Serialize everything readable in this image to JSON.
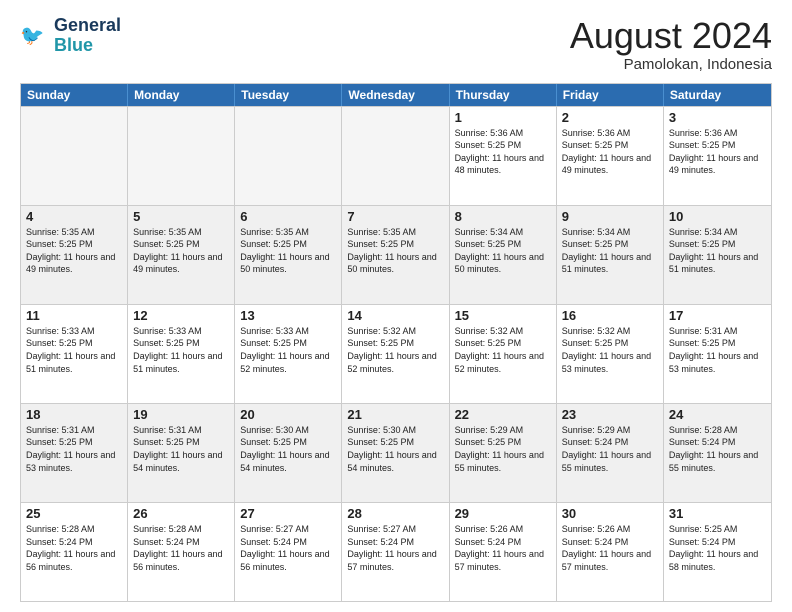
{
  "logo": {
    "line1": "General",
    "line2": "Blue"
  },
  "title": "August 2024",
  "location": "Pamolokan, Indonesia",
  "days": [
    "Sunday",
    "Monday",
    "Tuesday",
    "Wednesday",
    "Thursday",
    "Friday",
    "Saturday"
  ],
  "rows": [
    [
      {
        "day": "",
        "empty": true
      },
      {
        "day": "",
        "empty": true
      },
      {
        "day": "",
        "empty": true
      },
      {
        "day": "",
        "empty": true
      },
      {
        "day": "1",
        "sunrise": "5:36 AM",
        "sunset": "5:25 PM",
        "daylight": "11 hours and 48 minutes."
      },
      {
        "day": "2",
        "sunrise": "5:36 AM",
        "sunset": "5:25 PM",
        "daylight": "11 hours and 49 minutes."
      },
      {
        "day": "3",
        "sunrise": "5:36 AM",
        "sunset": "5:25 PM",
        "daylight": "11 hours and 49 minutes."
      }
    ],
    [
      {
        "day": "4",
        "sunrise": "5:35 AM",
        "sunset": "5:25 PM",
        "daylight": "11 hours and 49 minutes."
      },
      {
        "day": "5",
        "sunrise": "5:35 AM",
        "sunset": "5:25 PM",
        "daylight": "11 hours and 49 minutes."
      },
      {
        "day": "6",
        "sunrise": "5:35 AM",
        "sunset": "5:25 PM",
        "daylight": "11 hours and 50 minutes."
      },
      {
        "day": "7",
        "sunrise": "5:35 AM",
        "sunset": "5:25 PM",
        "daylight": "11 hours and 50 minutes."
      },
      {
        "day": "8",
        "sunrise": "5:34 AM",
        "sunset": "5:25 PM",
        "daylight": "11 hours and 50 minutes."
      },
      {
        "day": "9",
        "sunrise": "5:34 AM",
        "sunset": "5:25 PM",
        "daylight": "11 hours and 51 minutes."
      },
      {
        "day": "10",
        "sunrise": "5:34 AM",
        "sunset": "5:25 PM",
        "daylight": "11 hours and 51 minutes."
      }
    ],
    [
      {
        "day": "11",
        "sunrise": "5:33 AM",
        "sunset": "5:25 PM",
        "daylight": "11 hours and 51 minutes."
      },
      {
        "day": "12",
        "sunrise": "5:33 AM",
        "sunset": "5:25 PM",
        "daylight": "11 hours and 51 minutes."
      },
      {
        "day": "13",
        "sunrise": "5:33 AM",
        "sunset": "5:25 PM",
        "daylight": "11 hours and 52 minutes."
      },
      {
        "day": "14",
        "sunrise": "5:32 AM",
        "sunset": "5:25 PM",
        "daylight": "11 hours and 52 minutes."
      },
      {
        "day": "15",
        "sunrise": "5:32 AM",
        "sunset": "5:25 PM",
        "daylight": "11 hours and 52 minutes."
      },
      {
        "day": "16",
        "sunrise": "5:32 AM",
        "sunset": "5:25 PM",
        "daylight": "11 hours and 53 minutes."
      },
      {
        "day": "17",
        "sunrise": "5:31 AM",
        "sunset": "5:25 PM",
        "daylight": "11 hours and 53 minutes."
      }
    ],
    [
      {
        "day": "18",
        "sunrise": "5:31 AM",
        "sunset": "5:25 PM",
        "daylight": "11 hours and 53 minutes."
      },
      {
        "day": "19",
        "sunrise": "5:31 AM",
        "sunset": "5:25 PM",
        "daylight": "11 hours and 54 minutes."
      },
      {
        "day": "20",
        "sunrise": "5:30 AM",
        "sunset": "5:25 PM",
        "daylight": "11 hours and 54 minutes."
      },
      {
        "day": "21",
        "sunrise": "5:30 AM",
        "sunset": "5:25 PM",
        "daylight": "11 hours and 54 minutes."
      },
      {
        "day": "22",
        "sunrise": "5:29 AM",
        "sunset": "5:25 PM",
        "daylight": "11 hours and 55 minutes."
      },
      {
        "day": "23",
        "sunrise": "5:29 AM",
        "sunset": "5:24 PM",
        "daylight": "11 hours and 55 minutes."
      },
      {
        "day": "24",
        "sunrise": "5:28 AM",
        "sunset": "5:24 PM",
        "daylight": "11 hours and 55 minutes."
      }
    ],
    [
      {
        "day": "25",
        "sunrise": "5:28 AM",
        "sunset": "5:24 PM",
        "daylight": "11 hours and 56 minutes."
      },
      {
        "day": "26",
        "sunrise": "5:28 AM",
        "sunset": "5:24 PM",
        "daylight": "11 hours and 56 minutes."
      },
      {
        "day": "27",
        "sunrise": "5:27 AM",
        "sunset": "5:24 PM",
        "daylight": "11 hours and 56 minutes."
      },
      {
        "day": "28",
        "sunrise": "5:27 AM",
        "sunset": "5:24 PM",
        "daylight": "11 hours and 57 minutes."
      },
      {
        "day": "29",
        "sunrise": "5:26 AM",
        "sunset": "5:24 PM",
        "daylight": "11 hours and 57 minutes."
      },
      {
        "day": "30",
        "sunrise": "5:26 AM",
        "sunset": "5:24 PM",
        "daylight": "11 hours and 57 minutes."
      },
      {
        "day": "31",
        "sunrise": "5:25 AM",
        "sunset": "5:24 PM",
        "daylight": "11 hours and 58 minutes."
      }
    ]
  ]
}
